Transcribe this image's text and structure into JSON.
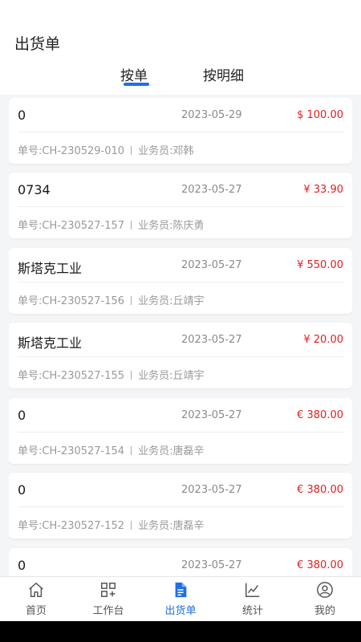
{
  "header": {
    "title": "出货单",
    "tabs": [
      {
        "label": "按单",
        "active": true
      },
      {
        "label": "按明细",
        "active": false
      }
    ],
    "accent_color": "#1e6fe8"
  },
  "orders": [
    {
      "name": "0",
      "date": "2023-05-29",
      "amount": "$ 100.00",
      "order_no": "单号:CH-230529-010",
      "salesperson": "业务员:邓韩"
    },
    {
      "name": "0734",
      "date": "2023-05-27",
      "amount": "¥ 33.90",
      "order_no": "单号:CH-230527-157",
      "salesperson": "业务员:陈庆勇"
    },
    {
      "name": "斯塔克工业",
      "date": "2023-05-27",
      "amount": "¥ 550.00",
      "order_no": "单号:CH-230527-156",
      "salesperson": "业务员:丘靖宇"
    },
    {
      "name": "斯塔克工业",
      "date": "2023-05-27",
      "amount": "¥ 20.00",
      "order_no": "单号:CH-230527-155",
      "salesperson": "业务员:丘靖宇"
    },
    {
      "name": "0",
      "date": "2023-05-27",
      "amount": "€ 380.00",
      "order_no": "单号:CH-230527-154",
      "salesperson": "业务员:唐磊辛"
    },
    {
      "name": "0",
      "date": "2023-05-27",
      "amount": "€ 380.00",
      "order_no": "单号:CH-230527-152",
      "salesperson": "业务员:唐磊辛"
    },
    {
      "name": "0",
      "date": "2023-05-27",
      "amount": "€ 380.00",
      "order_no": "",
      "salesperson": ""
    }
  ],
  "amount_color": "#e02020",
  "tabbar": {
    "items": [
      {
        "label": "首页",
        "icon": "home-icon",
        "active": false
      },
      {
        "label": "工作台",
        "icon": "workbench-icon",
        "active": false
      },
      {
        "label": "出货单",
        "icon": "document-icon",
        "active": true
      },
      {
        "label": "统计",
        "icon": "chart-icon",
        "active": false
      },
      {
        "label": "我的",
        "icon": "profile-icon",
        "active": false
      }
    ]
  }
}
